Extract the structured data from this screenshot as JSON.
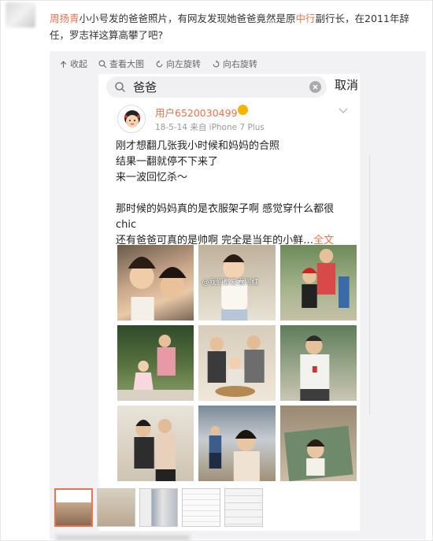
{
  "post": {
    "author": "周扬青",
    "text_a": "小小号发的爸爸照片，有网友发现她爸爸竟然是原",
    "link": "中行",
    "text_b": "副行长，在2011年辞任，罗志祥这算高攀了吧?"
  },
  "toolbar": {
    "collapse": "收起",
    "view_large": "查看大图",
    "rotate_left": "向左旋转",
    "rotate_right": "向右旋转"
  },
  "screenshot": {
    "search_value": "爸爸",
    "cancel": "取消",
    "username": "用户6520030499",
    "meta": "18-5-14  来自 iPhone 7 Plus",
    "line1": "刚才想翻几张我小时候和妈妈的合照",
    "line2": "结果一翻就停不下来了",
    "line3": "来一波回忆杀～",
    "line4": "那时候的妈妈真的是衣服架子啊 感觉穿什么都很chic",
    "line5": "还有爸爸可真的是帅啊 完全是当年的小鲜…",
    "more": "全文",
    "watermark": "@我们都爱看网红"
  },
  "thumbnails_count": 5
}
